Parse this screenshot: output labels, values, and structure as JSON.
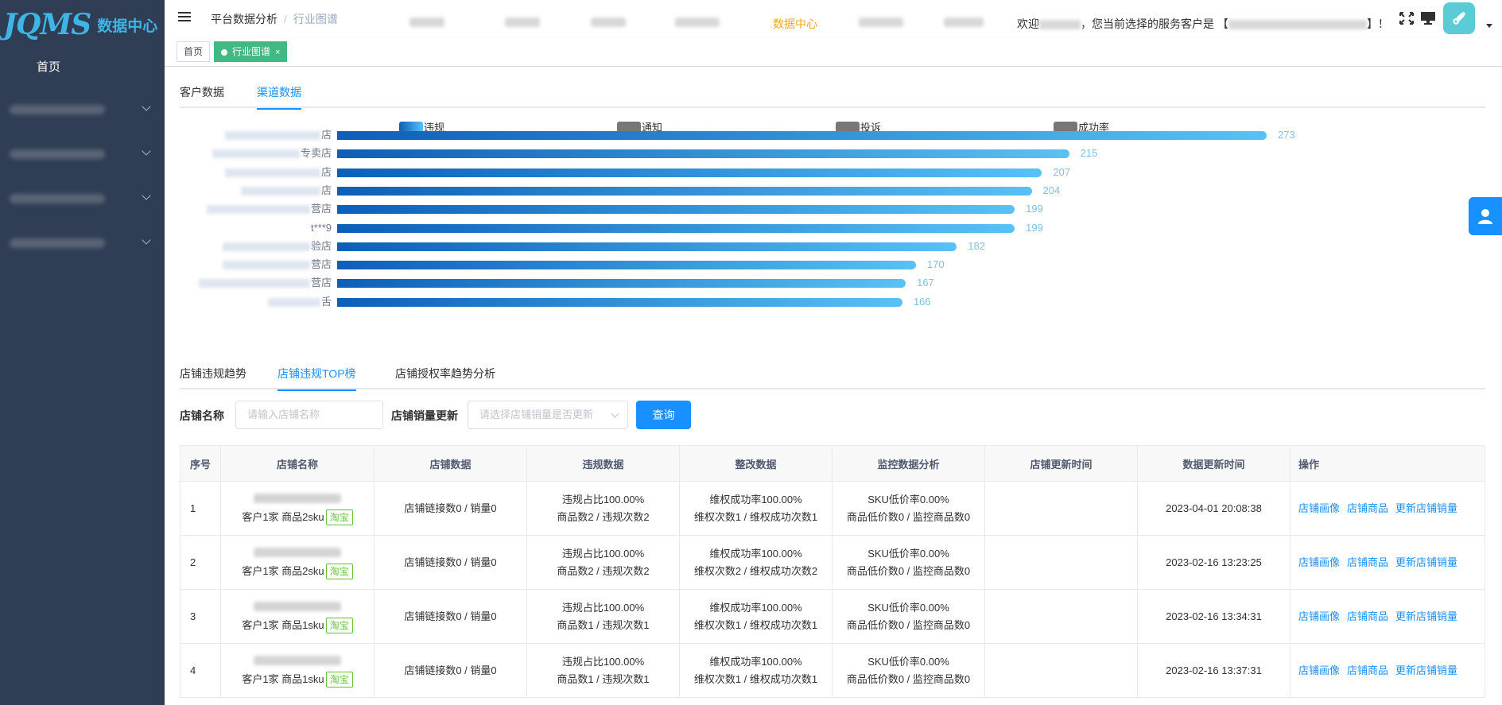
{
  "sidebar": {
    "logo_mark": "JQMS",
    "logo_text": "数据中心",
    "home_label": "首页"
  },
  "header": {
    "breadcrumb": [
      "平台数据分析",
      "行业图谱"
    ],
    "active_nav": "数据中心",
    "welcome_prefix": "欢迎",
    "welcome_middle": "，您当前选择的服务客户是 【",
    "welcome_suffix": "】！"
  },
  "tags_bar": {
    "home": "首页",
    "active": "行业图谱",
    "close": "×"
  },
  "top_tabs": {
    "items": [
      "客户数据",
      "渠道数据"
    ],
    "active_index": 1
  },
  "chart_data": {
    "type": "bar",
    "orientation": "horizontal",
    "legend": [
      "违规",
      "通知",
      "投诉",
      "成功率"
    ],
    "legend_colors": [
      "#1f74d6",
      "#777777",
      "#777777",
      "#777777"
    ],
    "category_label_suffixes": [
      "店",
      "专卖店",
      "店",
      "店",
      "营店",
      "t***9",
      "验店",
      "营店",
      "营店",
      "舌"
    ],
    "values": [
      273,
      215,
      207,
      204,
      199,
      199,
      182,
      170,
      167,
      166
    ],
    "xlim": [
      0,
      273
    ],
    "bar_color_start": "#0c5fb8",
    "bar_color_end": "#58c1f5"
  },
  "sub_tabs": {
    "items": [
      "店铺违规趋势",
      "店铺违规TOP榜",
      "店铺授权率趋势分析"
    ],
    "active_index": 1
  },
  "filters": {
    "shop_name_label": "店铺名称",
    "shop_name_placeholder": "请输入店铺名称",
    "sales_update_label": "店铺销量更新",
    "sales_update_placeholder": "请选择店铺销量是否更新",
    "query_button": "查询"
  },
  "table": {
    "columns": [
      "序号",
      "店铺名称",
      "店铺数据",
      "违规数据",
      "整改数据",
      "监控数据分析",
      "店铺更新时间",
      "数据更新时间",
      "操作"
    ],
    "actions": [
      "店铺画像",
      "店铺商品",
      "更新店铺销量"
    ],
    "rows": [
      {
        "idx": "1",
        "shop_sub": "客户1家 商品2sku",
        "platform": "淘宝",
        "shop_data": "店铺链接数0 / 销量0",
        "violation_1": "违规占比100.00%",
        "violation_2": "商品数2 / 违规次数2",
        "rectify_1": "维权成功率100.00%",
        "rectify_2": "维权次数1 / 维权成功次数1",
        "monitor_1": "SKU低价率0.00%",
        "monitor_2": "商品低价数0 / 监控商品数0",
        "shop_update": "",
        "data_update": "2023-04-01 20:08:38"
      },
      {
        "idx": "2",
        "shop_sub": "客户1家 商品2sku",
        "platform": "淘宝",
        "shop_data": "店铺链接数0 / 销量0",
        "violation_1": "违规占比100.00%",
        "violation_2": "商品数2 / 违规次数2",
        "rectify_1": "维权成功率100.00%",
        "rectify_2": "维权次数2 / 维权成功次数2",
        "monitor_1": "SKU低价率0.00%",
        "monitor_2": "商品低价数0 / 监控商品数0",
        "shop_update": "",
        "data_update": "2023-02-16 13:23:25"
      },
      {
        "idx": "3",
        "shop_sub": "客户1家 商品1sku",
        "platform": "淘宝",
        "shop_data": "店铺链接数0 / 销量0",
        "violation_1": "违规占比100.00%",
        "violation_2": "商品数1 / 违规次数1",
        "rectify_1": "维权成功率100.00%",
        "rectify_2": "维权次数1 / 维权成功次数1",
        "monitor_1": "SKU低价率0.00%",
        "monitor_2": "商品低价数0 / 监控商品数0",
        "shop_update": "",
        "data_update": "2023-02-16 13:34:31"
      },
      {
        "idx": "4",
        "shop_sub": "客户1家 商品1sku",
        "platform": "淘宝",
        "shop_data": "店铺链接数0 / 销量0",
        "violation_1": "违规占比100.00%",
        "violation_2": "商品数1 / 违规次数1",
        "rectify_1": "维权成功率100.00%",
        "rectify_2": "维权次数1 / 维权成功次数1",
        "monitor_1": "SKU低价率0.00%",
        "monitor_2": "商品低价数0 / 监控商品数0",
        "shop_update": "",
        "data_update": "2023-02-16 13:37:31"
      }
    ]
  },
  "icons": {
    "hamburger": "menu-fold-icon",
    "fullscreen": "fullscreen-icon",
    "screen": "monitor-icon",
    "float": "user-icon"
  }
}
